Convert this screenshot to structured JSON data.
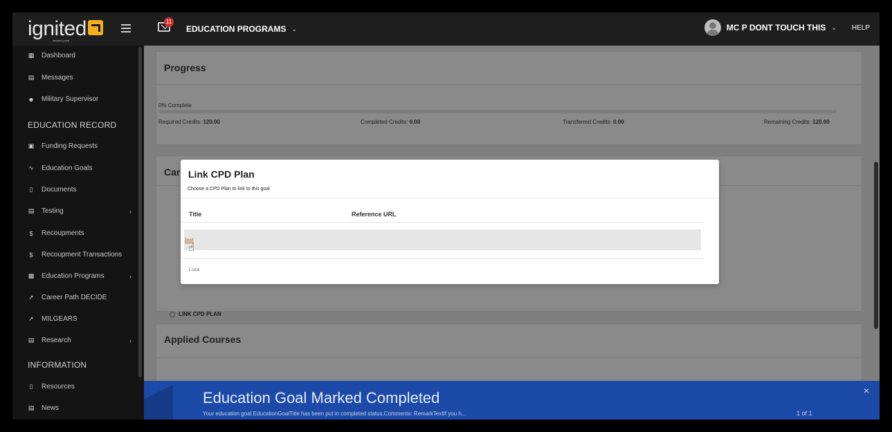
{
  "brand": {
    "logo": "ignited",
    "tagline": "student portal"
  },
  "topbar": {
    "mail_badge": "11",
    "program_menu": "EDUCATION PROGRAMS",
    "user_name": "MC P DONT TOUCH THIS",
    "help": "HELP"
  },
  "sidebar": {
    "items_top": [
      {
        "label": "Dashboard",
        "icon": "dashboard-icon"
      },
      {
        "label": "Messages",
        "icon": "messages-icon"
      },
      {
        "label": "Military Supervisor",
        "icon": "users-icon"
      }
    ],
    "section_education": "EDUCATION RECORD",
    "items_edu": [
      {
        "label": "Funding Requests",
        "icon": "funding-icon"
      },
      {
        "label": "Education Goals",
        "icon": "goals-icon"
      },
      {
        "label": "Documents",
        "icon": "document-icon"
      },
      {
        "label": "Testing",
        "icon": "testing-icon"
      },
      {
        "label": "Recoupments",
        "icon": "dollar-icon"
      },
      {
        "label": "Recoupment Transactions",
        "icon": "dollar-icon"
      },
      {
        "label": "Education Programs",
        "icon": "programs-icon"
      },
      {
        "label": "Career Path DECIDE",
        "icon": "career-icon"
      },
      {
        "label": "MILGEARS",
        "icon": "milgears-icon"
      },
      {
        "label": "Research",
        "icon": "research-icon"
      }
    ],
    "section_information": "INFORMATION",
    "items_info": [
      {
        "label": "Resources",
        "icon": "resources-icon"
      },
      {
        "label": "News",
        "icon": "news-icon"
      }
    ]
  },
  "progress": {
    "title": "Progress",
    "complete_label": "0% Complete",
    "percent": 0,
    "required_label": "Required Credits:",
    "required_value": "120.00",
    "completed_label": "Completed Credits:",
    "completed_value": "0.00",
    "transferred_label": "Transferred Credits:",
    "transferred_value": "0.00",
    "remaining_label": "Remaining Credits:",
    "remaining_value": "120.00"
  },
  "career": {
    "title_partial": "Care",
    "link_plan": "LINK CPD PLAN"
  },
  "applied": {
    "title": "Applied Courses"
  },
  "modal": {
    "title": "Link CPD Plan",
    "subtitle": "Choose a CPD Plan to link to this goal",
    "col_title": "Title",
    "col_url": "Reference URL",
    "row_title": "test",
    "total": "1 total"
  },
  "notification": {
    "title": "Education Goal Marked Completed",
    "text": "Your education goal EducationGoalTitle has been put in completed status.Comments: RemarkTextIf you h...",
    "pager": "1 of 1",
    "close": "×"
  }
}
